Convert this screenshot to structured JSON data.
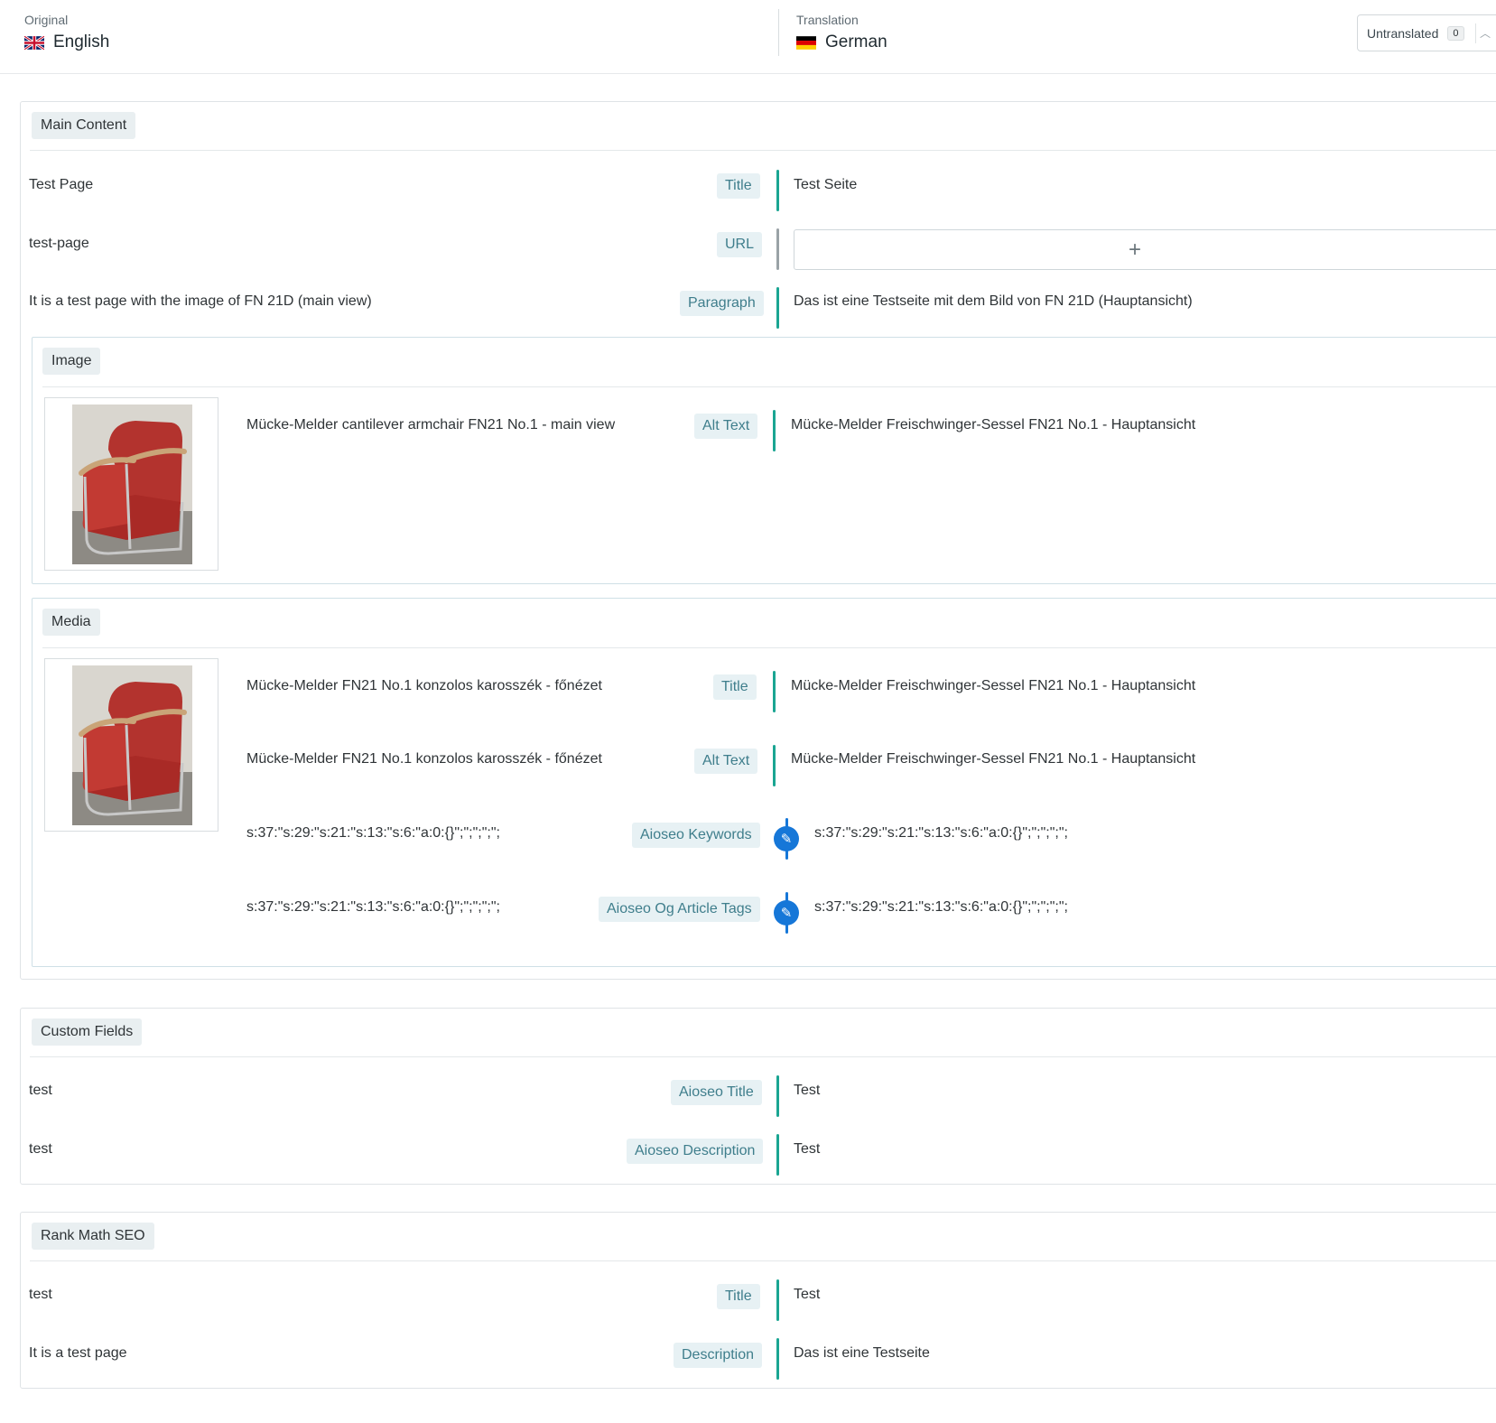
{
  "header": {
    "original_label": "Original",
    "original_lang": "English",
    "translation_label": "Translation",
    "translation_lang": "German",
    "status_filter": "Untranslated",
    "status_count": "0"
  },
  "main_content": {
    "tag": "Main Content",
    "rows": [
      {
        "source": "Test Page",
        "label": "Title",
        "target": "Test Seite"
      },
      {
        "source": "test-page",
        "label": "URL",
        "target": ""
      },
      {
        "source": "It is a test page with the image of FN 21D (main view)",
        "label": "Paragraph",
        "target": "Das ist eine Testseite mit dem Bild von FN 21D (Hauptansicht)"
      }
    ],
    "image_block": {
      "tag": "Image",
      "rows": [
        {
          "source": "Mücke-Melder cantilever armchair FN21 No.1 - main view",
          "label": "Alt Text",
          "target": "Mücke-Melder Freischwinger-Sessel FN21 No.1 - Hauptansicht"
        }
      ]
    },
    "media_block": {
      "tag": "Media",
      "rows": [
        {
          "source": "Mücke-Melder FN21 No.1 konzolos karosszék - főnézet",
          "label": "Title",
          "target": "Mücke-Melder Freischwinger-Sessel FN21 No.1 - Hauptansicht"
        },
        {
          "source": "Mücke-Melder FN21 No.1 konzolos karosszék - főnézet",
          "label": "Alt Text",
          "target": "Mücke-Melder Freischwinger-Sessel FN21 No.1 - Hauptansicht"
        },
        {
          "source": "s:37:\"s:29:\"s:21:\"s:13:\"s:6:\"a:0:{}\";\";\";\";\";",
          "label": "Aioseo Keywords",
          "target": "s:37:\"s:29:\"s:21:\"s:13:\"s:6:\"a:0:{}\";\";\";\";\";"
        },
        {
          "source": "s:37:\"s:29:\"s:21:\"s:13:\"s:6:\"a:0:{}\";\";\";\";\";",
          "label": "Aioseo Og Article Tags",
          "target": "s:37:\"s:29:\"s:21:\"s:13:\"s:6:\"a:0:{}\";\";\";\";\";"
        }
      ]
    }
  },
  "custom_fields": {
    "tag": "Custom Fields",
    "rows": [
      {
        "source": "test",
        "label": "Aioseo Title",
        "target": "Test"
      },
      {
        "source": "test",
        "label": "Aioseo Description",
        "target": "Test"
      }
    ]
  },
  "rank_math": {
    "tag": "Rank Math SEO",
    "rows": [
      {
        "source": "test",
        "label": "Title",
        "target": "Test"
      },
      {
        "source": "It is a test page",
        "label": "Description",
        "target": "Das ist eine Testseite"
      }
    ]
  },
  "colors": {
    "translated_bar": "#1aa592",
    "empty_bar": "#9aa2a6",
    "edit_bar": "#1677d8",
    "label_text": "#3f7e8c",
    "label_bg": "#e7f1f4"
  },
  "icons": [
    "uk-flag-icon",
    "germany-flag-icon",
    "chevron-up-icon",
    "plus-icon",
    "pencil-icon",
    "chair-image"
  ]
}
